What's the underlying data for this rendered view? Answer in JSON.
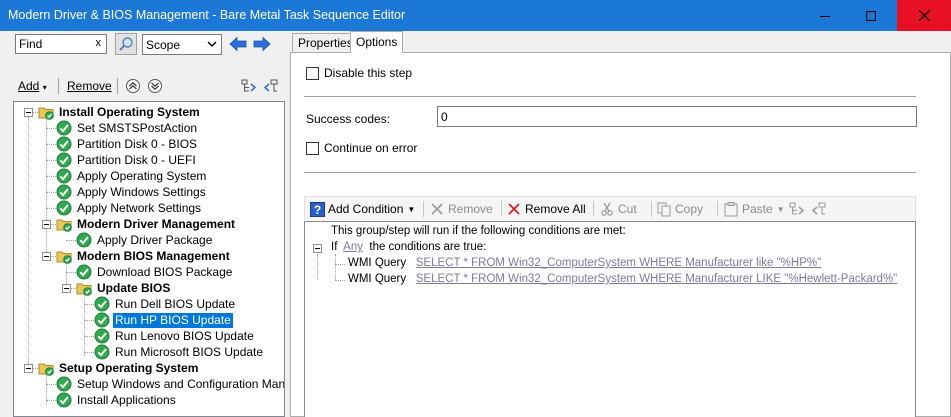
{
  "window": {
    "title": "Modern Driver & BIOS Management - Bare Metal Task Sequence Editor"
  },
  "search": {
    "value": "Find",
    "clear": "x",
    "scope": "Scope"
  },
  "left_toolbar": {
    "add_label": "Add",
    "remove_label": "Remove"
  },
  "tree": [
    {
      "label": "Install Operating System",
      "type": "group",
      "level": 0
    },
    {
      "label": "Set SMSTSPostAction",
      "type": "step",
      "level": 1
    },
    {
      "label": "Partition Disk 0 - BIOS",
      "type": "step",
      "level": 1
    },
    {
      "label": "Partition Disk 0 - UEFI",
      "type": "step",
      "level": 1
    },
    {
      "label": "Apply Operating System",
      "type": "step",
      "level": 1
    },
    {
      "label": "Apply Windows Settings",
      "type": "step",
      "level": 1
    },
    {
      "label": "Apply Network Settings",
      "type": "step",
      "level": 1
    },
    {
      "label": "Modern Driver Management",
      "type": "group",
      "level": 1
    },
    {
      "label": "Apply Driver Package",
      "type": "step",
      "level": 2
    },
    {
      "label": "Modern BIOS Management",
      "type": "group",
      "level": 1
    },
    {
      "label": "Download BIOS Package",
      "type": "step",
      "level": 2
    },
    {
      "label": "Update BIOS",
      "type": "group",
      "level": 2
    },
    {
      "label": "Run Dell BIOS Update",
      "type": "step",
      "level": 3
    },
    {
      "label": "Run HP BIOS Update",
      "type": "step",
      "level": 3,
      "selected": true
    },
    {
      "label": "Run Lenovo BIOS Update",
      "type": "step",
      "level": 3
    },
    {
      "label": "Run Microsoft BIOS Update",
      "type": "step",
      "level": 3
    },
    {
      "label": "Setup Operating System",
      "type": "group",
      "level": 0
    },
    {
      "label": "Setup Windows and Configuration Manager",
      "type": "step",
      "level": 1
    },
    {
      "label": "Install Applications",
      "type": "step",
      "level": 1
    }
  ],
  "tabs": {
    "properties": "Properties",
    "options": "Options"
  },
  "options": {
    "disable_step": "Disable this step",
    "success_codes_label": "Success codes:",
    "success_codes_value": "0",
    "continue_on_error": "Continue on error"
  },
  "condition_toolbar": {
    "add_condition": "Add Condition",
    "remove": "Remove",
    "remove_all": "Remove All",
    "cut": "Cut",
    "copy": "Copy",
    "paste": "Paste"
  },
  "conditions": {
    "header": "This group/step will run if the following conditions are met:",
    "if_label": "If",
    "any_link": "Any",
    "true_text": "the conditions are true:",
    "items": [
      {
        "type": "WMI Query",
        "query": "SELECT * FROM Win32_ComputerSystem WHERE Manufacturer like \"%HP%\""
      },
      {
        "type": "WMI Query",
        "query": "SELECT * FROM Win32_ComputerSystem WHERE Manufacturer LIKE \"%Hewlett-Packard%\""
      }
    ]
  },
  "colors": {
    "titlebar": "#1b78d6",
    "close": "#e81123",
    "selection": "#0078d7",
    "step_green": "#2fa84f",
    "folder": "#e8c65a"
  }
}
